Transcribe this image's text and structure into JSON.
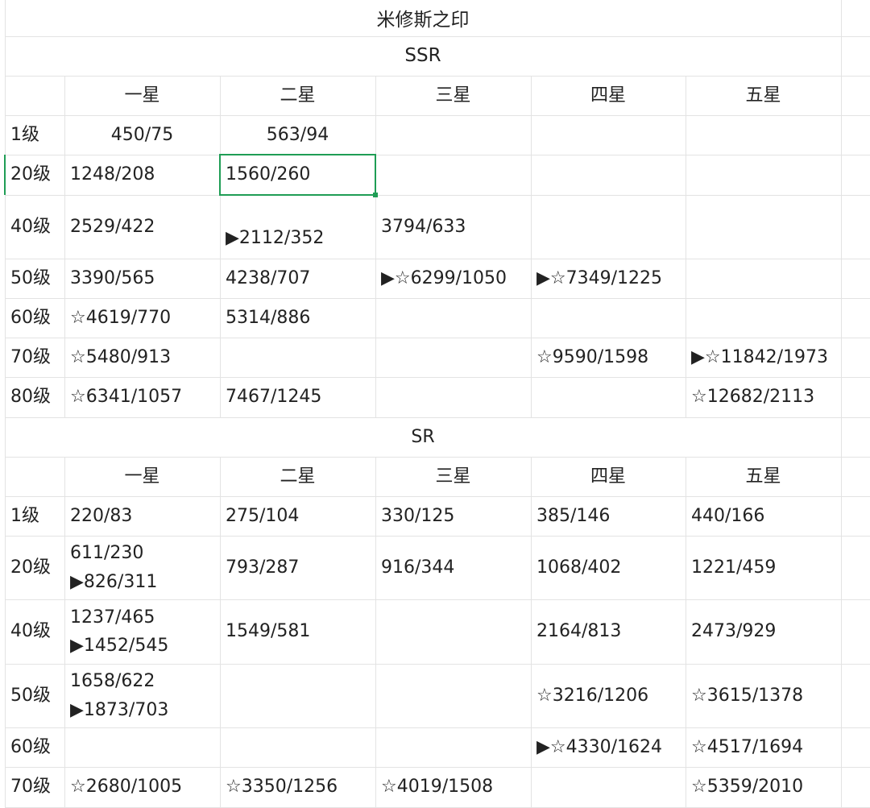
{
  "title": "米修斯之印",
  "ssr": {
    "label": "SSR",
    "stars": [
      "一星",
      "二星",
      "三星",
      "四星",
      "五星"
    ],
    "rows": [
      {
        "level": "1级",
        "cells": [
          "450/75",
          "563/94",
          "",
          "",
          ""
        ]
      },
      {
        "level": "20级",
        "cells": [
          "1248/208",
          "1560/260",
          "",
          "",
          ""
        ]
      },
      {
        "level": "40级",
        "cells": [
          "2529/422",
          "▶2112/352",
          "3794/633",
          "",
          ""
        ]
      },
      {
        "level": "50级",
        "cells": [
          "3390/565",
          "4238/707",
          "▶☆6299/1050",
          "▶☆7349/1225",
          ""
        ]
      },
      {
        "level": "60级",
        "cells": [
          "☆4619/770",
          "5314/886",
          "",
          "",
          ""
        ]
      },
      {
        "level": "70级",
        "cells": [
          "☆5480/913",
          "",
          "",
          "☆9590/1598",
          "▶☆11842/1973"
        ]
      },
      {
        "level": "80级",
        "cells": [
          "☆6341/1057",
          "7467/1245",
          "",
          "",
          "☆12682/2113"
        ]
      }
    ]
  },
  "sr": {
    "label": "SR",
    "stars": [
      "一星",
      "二星",
      "三星",
      "四星",
      "五星"
    ],
    "rows": [
      {
        "level": "1级",
        "cells": [
          [
            "220/83"
          ],
          [
            "275/104"
          ],
          [
            "330/125"
          ],
          [
            "385/146"
          ],
          [
            "440/166"
          ]
        ]
      },
      {
        "level": "20级",
        "cells": [
          [
            "611/230",
            "▶826/311"
          ],
          [
            "793/287"
          ],
          [
            "916/344"
          ],
          [
            "1068/402"
          ],
          [
            "1221/459"
          ]
        ]
      },
      {
        "level": "40级",
        "cells": [
          [
            "1237/465",
            "▶1452/545"
          ],
          [
            "1549/581"
          ],
          [],
          [
            "2164/813"
          ],
          [
            "2473/929"
          ]
        ]
      },
      {
        "level": "50级",
        "cells": [
          [
            "1658/622",
            "▶1873/703"
          ],
          [],
          [],
          [
            "☆3216/1206"
          ],
          [
            "☆3615/1378"
          ]
        ]
      },
      {
        "level": "60级",
        "cells": [
          [],
          [],
          [],
          [
            "▶☆4330/1624"
          ],
          [
            "☆4517/1694"
          ]
        ]
      },
      {
        "level": "70级",
        "cells": [
          [
            "☆2680/1005"
          ],
          [
            "☆3350/1256"
          ],
          [
            "☆4019/1508"
          ],
          [],
          [
            "☆5359/2010"
          ]
        ]
      }
    ]
  },
  "selection": {
    "section": "ssr",
    "row": 1,
    "col": 1
  }
}
